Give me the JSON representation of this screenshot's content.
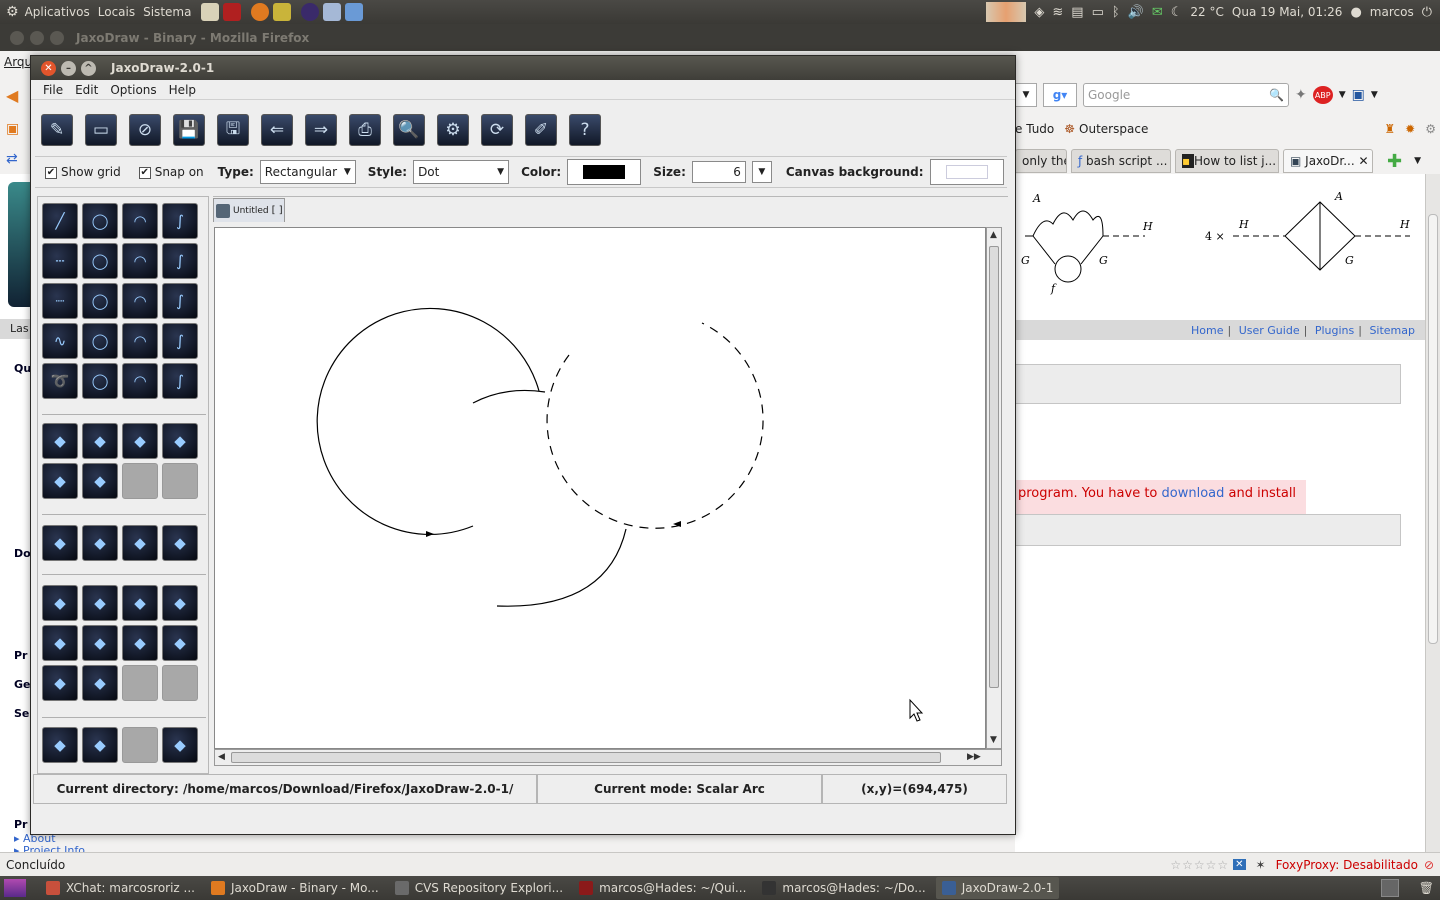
{
  "top_panel": {
    "menus": [
      "Aplicativos",
      "Locais",
      "Sistema"
    ],
    "temperature": "22 °C",
    "datetime": "Qua 19 Mai, 01:26",
    "user": "marcos"
  },
  "firefox": {
    "window_title": "JaxoDraw - Binary - Mozilla Firefox",
    "menu_partial": "Arqu",
    "search_placeholder": "Google",
    "bookmarks": [
      "e Tudo",
      "Outerspace"
    ],
    "tabs": [
      "only the...",
      "bash script ...",
      "How to list j...",
      "JaxoDr..."
    ],
    "nav_links": [
      "Home",
      "User Guide",
      "Plugins",
      "Sitemap"
    ],
    "warning_text_1": "program. You have to",
    "warning_link": "download",
    "warning_text_2": "and install",
    "status_text": "Concluído",
    "proxy_status": "FoxyProxy: Desabilitado",
    "sidebar_links": [
      "About",
      "Project Info"
    ],
    "sidebar_fragments": [
      "Las",
      "Qu",
      "Do",
      "Pr",
      "Ge",
      "Se",
      "Pr"
    ]
  },
  "taskbar": {
    "items": [
      {
        "label": "XChat: marcosroriz ...",
        "icon": "xchat-icon",
        "color": "#c8503c"
      },
      {
        "label": "JaxoDraw - Binary - Mo...",
        "icon": "firefox-icon",
        "color": "#e07a20"
      },
      {
        "label": "CVS Repository Explori...",
        "icon": "gear-icon",
        "color": "#6a6a6a"
      },
      {
        "label": "marcos@Hades: ~/Qui...",
        "icon": "terminal-icon",
        "color": "#8b1a1a"
      },
      {
        "label": "marcos@Hades: ~/Do...",
        "icon": "terminal-icon",
        "color": "#333333"
      },
      {
        "label": "JaxoDraw-2.0-1",
        "icon": "java-icon",
        "color": "#3a5f95"
      }
    ]
  },
  "jaxodraw": {
    "title": "JaxoDraw-2.0-1",
    "menus": [
      "File",
      "Edit",
      "Options",
      "Help"
    ],
    "toolbar": [
      {
        "name": "new-icon",
        "glyph": "✎"
      },
      {
        "name": "open-icon",
        "glyph": "▭"
      },
      {
        "name": "close-graph-icon",
        "glyph": "⊘"
      },
      {
        "name": "save-icon",
        "glyph": "💾"
      },
      {
        "name": "save-as-icon",
        "glyph": "🖫"
      },
      {
        "name": "import-icon",
        "glyph": "⇐"
      },
      {
        "name": "export-icon",
        "glyph": "⇒"
      },
      {
        "name": "print-icon",
        "glyph": "⎙"
      },
      {
        "name": "preview-icon",
        "glyph": "🔍"
      },
      {
        "name": "latex-icon",
        "glyph": "⚙"
      },
      {
        "name": "refresh-icon",
        "glyph": "⟳"
      },
      {
        "name": "preferences-icon",
        "glyph": "✐"
      },
      {
        "name": "help-icon",
        "glyph": "?"
      }
    ],
    "options": {
      "show_grid": "Show grid",
      "snap_on": "Snap on",
      "type_label": "Type:",
      "type_value": "Rectangular",
      "style_label": "Style:",
      "style_value": "Dot",
      "color_label": "Color:",
      "color_value": "#000000",
      "size_label": "Size:",
      "size_value": "6",
      "canvas_bg_label": "Canvas background:",
      "canvas_bg_value": "#ffffff"
    },
    "palette": {
      "particles": [
        "fermion-line",
        "fermion-loop",
        "fermion-arc",
        "fermion-bezier",
        "scalar-line",
        "scalar-loop",
        "scalar-arc",
        "scalar-bezier",
        "ghost-line",
        "ghost-loop",
        "ghost-arc",
        "ghost-bezier",
        "photon-line",
        "photon-loop",
        "photon-arc",
        "photon-bezier",
        "gluon-line",
        "gluon-loop",
        "gluon-arc",
        "gluon-bezier"
      ],
      "misc": [
        "zigzag",
        "box",
        "ellipse",
        "blob",
        "vertex",
        "zigzag-vertex",
        "empty",
        "empty"
      ],
      "edit": [
        "undo",
        "redo",
        "clear",
        "refresh"
      ],
      "actions": [
        "move",
        "resize",
        "color",
        "edit",
        "duplicate",
        "group",
        "ungroup",
        "delete",
        "select",
        "unselect",
        "empty",
        "empty"
      ],
      "grid": [
        "grid",
        "text",
        "empty",
        "default"
      ]
    },
    "canvas_tab": "Untitled",
    "status": {
      "directory": "Current directory: /home/marcos/Download/Firefox/JaxoDraw-2.0-1/",
      "mode": "Current mode: Scalar Arc",
      "coords": "(x,y)=(694,475)"
    }
  }
}
